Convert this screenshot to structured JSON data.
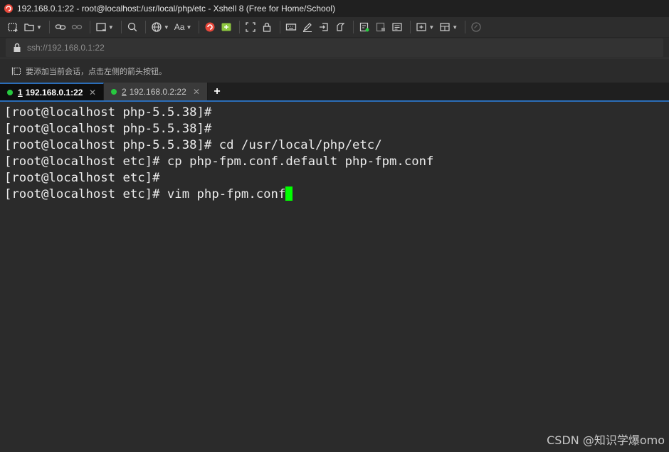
{
  "window": {
    "title": "192.168.0.1:22 - root@localhost:/usr/local/php/etc - Xshell 8 (Free for Home/School)"
  },
  "toolbar": {
    "buttons": [
      "new-session-icon",
      "open-folder-icon",
      "link-icon",
      "unlink-icon",
      "window-icon",
      "search-icon",
      "globe-icon",
      "font-icon",
      "xshell-icon",
      "xftp-icon",
      "fullscreen-icon",
      "lock-icon",
      "keyboard-icon",
      "script-icon",
      "transfer-icon",
      "edit-icon",
      "compose-icon",
      "log-icon",
      "notes-icon",
      "add-tab-icon",
      "layout-icon",
      "help-icon"
    ],
    "font_label": "Aa"
  },
  "address": {
    "value": "ssh://192.168.0.1:22"
  },
  "hint": {
    "text": "要添加当前会话，点击左侧的箭头按钮。"
  },
  "tabs": [
    {
      "number": "1",
      "label": "192.168.0.1:22",
      "active": true,
      "status_color": "#27c93f"
    },
    {
      "number": "2",
      "label": "192.168.0.2:22",
      "active": false,
      "status_color": "#27c93f"
    }
  ],
  "tab_add_label": "+",
  "terminal": {
    "lines": [
      "[root@localhost php-5.5.38]#",
      "[root@localhost php-5.5.38]#",
      "[root@localhost php-5.5.38]# cd /usr/local/php/etc/",
      "[root@localhost etc]# cp php-fpm.conf.default php-fpm.conf",
      "[root@localhost etc]#",
      "[root@localhost etc]# vim php-fpm.conf"
    ],
    "cursor_color": "#00ff00"
  },
  "watermark": "CSDN @知识学爆omo"
}
